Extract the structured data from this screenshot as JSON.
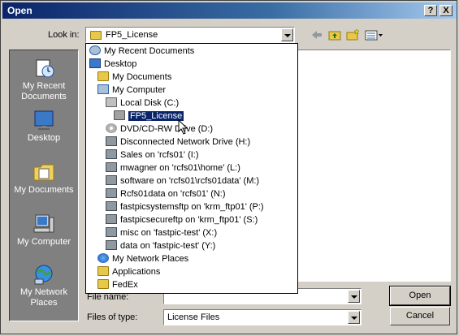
{
  "dialog": {
    "title": "Open",
    "help_button": "?",
    "close_button": "X"
  },
  "look_in": {
    "label": "Look in:",
    "value": "FP5_License"
  },
  "places_bar": [
    {
      "label": "My Recent Documents",
      "icon": "recent-documents-icon"
    },
    {
      "label": "Desktop",
      "icon": "desktop-icon"
    },
    {
      "label": "My Documents",
      "icon": "my-documents-icon"
    },
    {
      "label": "My Computer",
      "icon": "my-computer-icon"
    },
    {
      "label": "My Network Places",
      "icon": "network-places-icon"
    }
  ],
  "dropdown_items": [
    {
      "label": "My Recent Documents",
      "icon": "recent"
    },
    {
      "label": "Desktop",
      "icon": "desktop"
    },
    {
      "label": "My Documents",
      "icon": "folder"
    },
    {
      "label": "My Computer",
      "icon": "computer"
    },
    {
      "label": "Local Disk (C:)",
      "icon": "drive"
    },
    {
      "label": "FP5_License",
      "icon": "folder",
      "selected": true
    },
    {
      "label": "DVD/CD-RW Drive (D:)",
      "icon": "disc"
    },
    {
      "label": "Disconnected Network Drive (H:)",
      "icon": "net"
    },
    {
      "label": "Sales on 'rcfs01' (I:)",
      "icon": "net"
    },
    {
      "label": "mwagner on 'rcfs01\\home' (L:)",
      "icon": "net"
    },
    {
      "label": "software on 'rcfs01\\rcfs01data' (M:)",
      "icon": "net"
    },
    {
      "label": "Rcfs01data on 'rcfs01' (N:)",
      "icon": "net"
    },
    {
      "label": "fastpicsystemsftp on 'krm_ftp01' (P:)",
      "icon": "net"
    },
    {
      "label": "fastpicsecureftp on 'krm_ftp01' (S:)",
      "icon": "net"
    },
    {
      "label": "misc on 'fastpic-test' (X:)",
      "icon": "net"
    },
    {
      "label": "data on 'fastpic-test' (Y:)",
      "icon": "net"
    },
    {
      "label": "My Network Places",
      "icon": "globe"
    },
    {
      "label": "Applications",
      "icon": "folder"
    },
    {
      "label": "FedEx",
      "icon": "folder"
    }
  ],
  "file_name": {
    "label": "File name:",
    "value": ""
  },
  "files_of_type": {
    "label": "Files of type:",
    "value": "License Files"
  },
  "buttons": {
    "open": "Open",
    "cancel": "Cancel"
  }
}
